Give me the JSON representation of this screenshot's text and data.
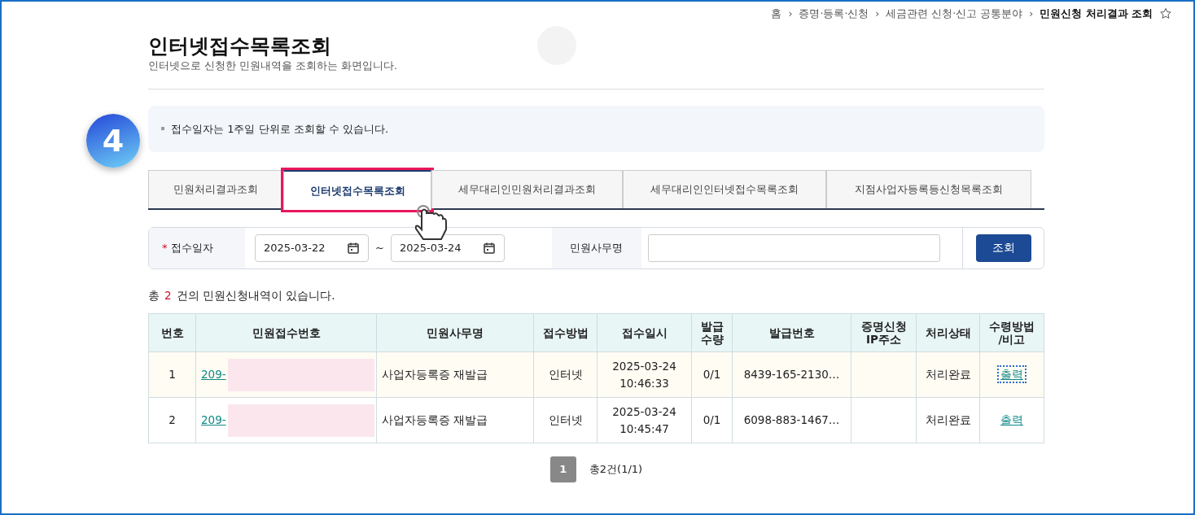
{
  "breadcrumb": {
    "items": [
      {
        "label": "홈",
        "current": false
      },
      {
        "label": "증명·등록·신청",
        "current": false
      },
      {
        "label": "세금관련 신청·신고 공통분야",
        "current": false
      },
      {
        "label": "민원신청 처리결과 조회",
        "current": true
      }
    ],
    "separator": "›"
  },
  "page": {
    "title": "인터넷접수목록조회",
    "subtitle": "인터넷으로 신청한 민원내역을 조회하는 화면입니다."
  },
  "step_badge": "4",
  "notice": "접수일자는 1주일 단위로 조회할 수 있습니다.",
  "tabs": [
    {
      "label": "민원처리결과조회",
      "selected": false,
      "highlighted": false
    },
    {
      "label": "인터넷접수목록조회",
      "selected": true,
      "highlighted": true
    },
    {
      "label": "세무대리인민원처리결과조회",
      "selected": false,
      "highlighted": false
    },
    {
      "label": "세무대리인인터넷접수목록조회",
      "selected": false,
      "highlighted": false
    },
    {
      "label": "지점사업자등록등신청목록조회",
      "selected": false,
      "highlighted": false
    }
  ],
  "search": {
    "date_label": "접수일자",
    "required": true,
    "required_mark": "*",
    "date_from": "2025-03-22",
    "date_to": "2025-03-24",
    "range_separator": "~",
    "name_label": "민원사무명",
    "search_button": "조회"
  },
  "summary": {
    "prefix": "총",
    "count": "2",
    "suffix": "건의 민원신청내역이 있습니다."
  },
  "table": {
    "columns": [
      "번호",
      "민원접수번호",
      "민원사무명",
      "접수방법",
      "접수일시",
      "발급\n수량",
      "발급번호",
      "증명신청\nIP주소",
      "처리상태",
      "수령방법\n/비고"
    ],
    "rows": [
      {
        "no": "1",
        "receipt_no": "209-",
        "service": "사업자등록증 재발급",
        "method": "인터넷",
        "date": "2025-03-24",
        "time": "10:46:33",
        "qty": "0/1",
        "issue_no": "8439-165-2130…",
        "status": "처리완료",
        "action": "출력",
        "focused": true,
        "highlighted": true
      },
      {
        "no": "2",
        "receipt_no": "209-",
        "service": "사업자등록증 재발급",
        "method": "인터넷",
        "date": "2025-03-24",
        "time": "10:45:47",
        "qty": "0/1",
        "issue_no": "6098-883-1467…",
        "status": "처리완료",
        "action": "출력",
        "focused": false,
        "highlighted": false
      }
    ]
  },
  "pagination": {
    "pages": [
      {
        "label": "1",
        "selected": true
      }
    ],
    "total": "총2건(1/1)"
  }
}
